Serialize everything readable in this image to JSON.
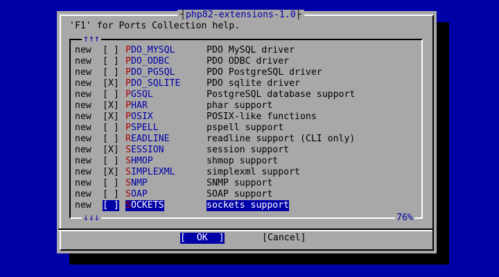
{
  "window": {
    "title": "php82-extensions-1.0"
  },
  "help_text": "'F1' for Ports Collection help.",
  "scroll": {
    "up": "↑↑↑",
    "down": "↓↓↓",
    "percent": "76%"
  },
  "items": [
    {
      "tag": "new",
      "check": "[ ]",
      "hotkey": "P",
      "rest": "DO_MYSQL",
      "desc": "PDO MySQL driver",
      "selected": false
    },
    {
      "tag": "new",
      "check": "[ ]",
      "hotkey": "P",
      "rest": "DO_ODBC",
      "desc": "PDO ODBC driver",
      "selected": false
    },
    {
      "tag": "new",
      "check": "[ ]",
      "hotkey": "P",
      "rest": "DO_PGSQL",
      "desc": "PDO PostgreSQL driver",
      "selected": false
    },
    {
      "tag": "new",
      "check": "[X]",
      "hotkey": "P",
      "rest": "DO_SQLITE",
      "desc": "PDO sqlite driver",
      "selected": false
    },
    {
      "tag": "new",
      "check": "[ ]",
      "hotkey": "P",
      "rest": "GSQL",
      "desc": "PostgreSQL database support",
      "selected": false
    },
    {
      "tag": "new",
      "check": "[X]",
      "hotkey": "P",
      "rest": "HAR",
      "desc": "phar support",
      "selected": false
    },
    {
      "tag": "new",
      "check": "[X]",
      "hotkey": "P",
      "rest": "OSIX",
      "desc": "POSIX-like functions",
      "selected": false
    },
    {
      "tag": "new",
      "check": "[ ]",
      "hotkey": "P",
      "rest": "SPELL",
      "desc": "pspell support",
      "selected": false
    },
    {
      "tag": "new",
      "check": "[ ]",
      "hotkey": "R",
      "rest": "EADLINE",
      "desc": "readline support (CLI only)",
      "selected": false
    },
    {
      "tag": "new",
      "check": "[X]",
      "hotkey": "S",
      "rest": "ESSION",
      "desc": "session support",
      "selected": false
    },
    {
      "tag": "new",
      "check": "[ ]",
      "hotkey": "S",
      "rest": "HMOP",
      "desc": "shmop support",
      "selected": false
    },
    {
      "tag": "new",
      "check": "[X]",
      "hotkey": "S",
      "rest": "IMPLEXML",
      "desc": "simplexml support",
      "selected": false
    },
    {
      "tag": "new",
      "check": "[ ]",
      "hotkey": "S",
      "rest": "NMP",
      "desc": "SNMP support",
      "selected": false
    },
    {
      "tag": "new",
      "check": "[ ]",
      "hotkey": "S",
      "rest": "OAP",
      "desc": "SOAP support",
      "selected": false
    },
    {
      "tag": "new",
      "check": "[ ]",
      "hotkey": "S",
      "rest": "OCKETS",
      "desc": "sockets support",
      "selected": true
    }
  ],
  "buttons": {
    "ok": "OK",
    "ok_left": "[  ",
    "ok_right": "  ]",
    "cancel": "[Cancel]"
  },
  "colors": {
    "background": "#0000a8",
    "dialog": "#a8a8a8",
    "hotkey": "#a80000",
    "selection": "#0000a8"
  }
}
